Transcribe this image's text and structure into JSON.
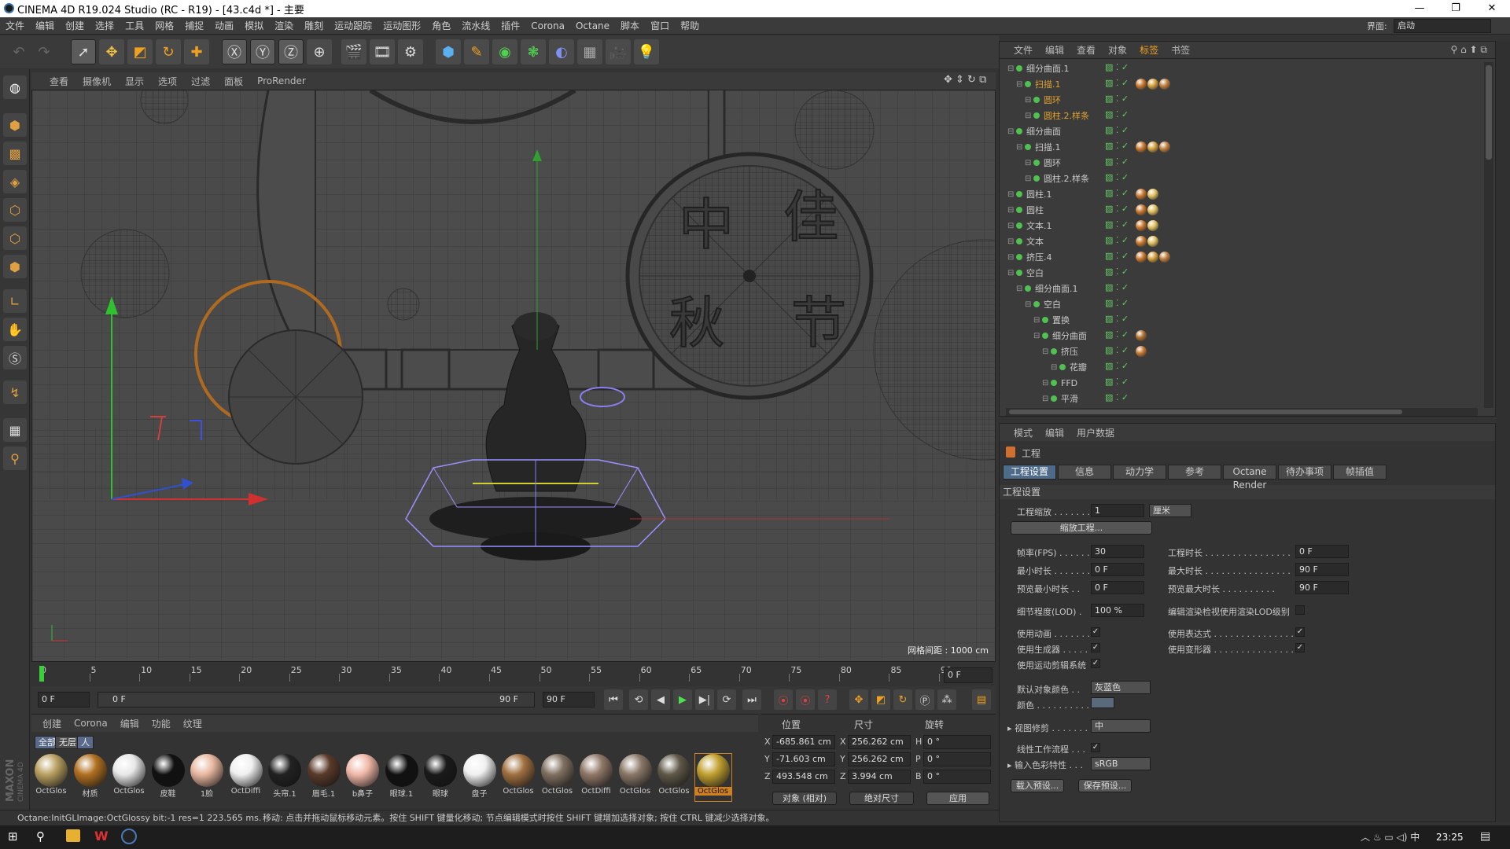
{
  "window": {
    "title": "CINEMA 4D R19.024 Studio (RC - R19) - [43.c4d *] - 主要"
  },
  "menubar": {
    "items": [
      "文件",
      "编辑",
      "创建",
      "选择",
      "工具",
      "网格",
      "捕捉",
      "动画",
      "模拟",
      "渲染",
      "雕刻",
      "运动跟踪",
      "运动图形",
      "角色",
      "流水线",
      "插件",
      "Corona",
      "Octane",
      "脚本",
      "窗口",
      "帮助"
    ],
    "layout_label": "界面:",
    "layout_value": "启动"
  },
  "viewport": {
    "menu": [
      "查看",
      "摄像机",
      "显示",
      "选项",
      "过滤",
      "面板",
      "ProRender"
    ],
    "grid_label": "网格间距 : 1000 cm",
    "characters": [
      "中",
      "佳",
      "秋",
      "节"
    ]
  },
  "timeline": {
    "ticks": [
      "0",
      "5",
      "10",
      "15",
      "20",
      "25",
      "30",
      "35",
      "40",
      "45",
      "50",
      "55",
      "60",
      "65",
      "70",
      "75",
      "80",
      "85",
      "90"
    ],
    "current_frame": "0 F",
    "start": "0 F",
    "range_start": "0 F",
    "range_end": "90 F",
    "end": "90 F"
  },
  "materials": {
    "menu": [
      "创建",
      "Corona",
      "编辑",
      "功能",
      "纹理"
    ],
    "tabs": [
      "全部",
      "无层",
      "人"
    ],
    "items": [
      {
        "label": "OctGlos",
        "color": "#b8a060"
      },
      {
        "label": "材质",
        "color": "#b07020"
      },
      {
        "label": "OctGlos",
        "color": "#e8e8e8"
      },
      {
        "label": "皮鞋",
        "color": "#111111"
      },
      {
        "label": "1脸",
        "color": "#e8b8a0"
      },
      {
        "label": "OctDiffi",
        "color": "#f0f0f0"
      },
      {
        "label": "头帘.1",
        "color": "#222222"
      },
      {
        "label": "眉毛.1",
        "color": "#5a3a2a"
      },
      {
        "label": "b鼻子",
        "color": "#f0b8a8"
      },
      {
        "label": "眼球.1",
        "color": "#111111"
      },
      {
        "label": "眼球",
        "color": "#1a1a1a"
      },
      {
        "label": "盘子",
        "color": "#f0f0f0"
      },
      {
        "label": "OctGlos",
        "color": "#a07040"
      },
      {
        "label": "OctGlos",
        "color": "#807060"
      },
      {
        "label": "OctDiffi",
        "color": "#907868"
      },
      {
        "label": "OctGlos",
        "color": "#8a7868"
      },
      {
        "label": "OctGlos",
        "color": "#605848"
      },
      {
        "label": "OctGlos",
        "color": "#c0a030"
      }
    ]
  },
  "coords": {
    "headers": [
      "位置",
      "尺寸",
      "旋转"
    ],
    "rows": [
      {
        "axis": "X",
        "pos": "-685.861 cm",
        "size_axis": "X",
        "size": "256.262 cm",
        "rot_axis": "H",
        "rot": "0 °"
      },
      {
        "axis": "Y",
        "pos": "-71.603 cm",
        "size_axis": "Y",
        "size": "256.262 cm",
        "rot_axis": "P",
        "rot": "0 °"
      },
      {
        "axis": "Z",
        "pos": "493.548 cm",
        "size_axis": "Z",
        "size": "3.994 cm",
        "rot_axis": "B",
        "rot": "0 °"
      }
    ],
    "mode": "对象 (相对)",
    "size_mode": "绝对尺寸",
    "apply": "应用"
  },
  "object_manager": {
    "menu": [
      "文件",
      "编辑",
      "查看",
      "对象",
      "标签",
      "书签"
    ],
    "rows": [
      {
        "name": "细分曲面.1",
        "indent": 0,
        "color": "#c8c8c8",
        "tags": []
      },
      {
        "name": "扫描.1",
        "indent": 1,
        "color": "#e0a030",
        "tags": [
          "#c87830",
          "#d4a040",
          "#c08040"
        ]
      },
      {
        "name": "圆环",
        "indent": 2,
        "color": "#e0a030",
        "tags": []
      },
      {
        "name": "圆柱.2.样条",
        "indent": 2,
        "color": "#e0a030",
        "tags": []
      },
      {
        "name": "细分曲面",
        "indent": 0,
        "color": "#c8c8c8",
        "tags": []
      },
      {
        "name": "扫描.1",
        "indent": 1,
        "color": "#c8c8c8",
        "tags": [
          "#c87830",
          "#d4a040",
          "#c08040"
        ]
      },
      {
        "name": "圆环",
        "indent": 2,
        "color": "#c8c8c8",
        "tags": []
      },
      {
        "name": "圆柱.2.样条",
        "indent": 2,
        "color": "#c8c8c8",
        "tags": []
      },
      {
        "name": "圆柱.1",
        "indent": 0,
        "color": "#c8c8c8",
        "tags": [
          "#c87830",
          "#e0c060"
        ]
      },
      {
        "name": "圆柱",
        "indent": 0,
        "color": "#c8c8c8",
        "tags": [
          "#c87830",
          "#e0c060"
        ]
      },
      {
        "name": "文本.1",
        "indent": 0,
        "color": "#c8c8c8",
        "tags": [
          "#c87830",
          "#e0c060"
        ]
      },
      {
        "name": "文本",
        "indent": 0,
        "color": "#c8c8c8",
        "tags": [
          "#c87830",
          "#e0c060"
        ]
      },
      {
        "name": "挤压.4",
        "indent": 0,
        "color": "#c8c8c8",
        "tags": [
          "#c87830",
          "#d4a040",
          "#c08040"
        ]
      },
      {
        "name": "空白",
        "indent": 0,
        "color": "#c8c8c8",
        "tags": []
      },
      {
        "name": "细分曲面.1",
        "indent": 1,
        "color": "#c8c8c8",
        "tags": []
      },
      {
        "name": "空白",
        "indent": 2,
        "color": "#c8c8c8",
        "tags": []
      },
      {
        "name": "置换",
        "indent": 3,
        "color": "#c8c8c8",
        "tags": []
      },
      {
        "name": "细分曲面",
        "indent": 3,
        "color": "#c8c8c8",
        "tags": [
          "#b07030"
        ]
      },
      {
        "name": "挤压",
        "indent": 4,
        "color": "#c8c8c8",
        "tags": [
          "#c87830"
        ]
      },
      {
        "name": "花瓣",
        "indent": 5,
        "color": "#c8c8c8",
        "tags": []
      },
      {
        "name": "FFD",
        "indent": 4,
        "color": "#c8c8c8",
        "tags": []
      },
      {
        "name": "平滑",
        "indent": 4,
        "color": "#c8c8c8",
        "tags": []
      }
    ]
  },
  "attributes": {
    "menu": [
      "模式",
      "编辑",
      "用户数据"
    ],
    "title": "工程",
    "tabs": [
      "工程设置",
      "信息",
      "动力学",
      "参考",
      "Octane Render",
      "待办事项",
      "帧插值"
    ],
    "section": "工程设置",
    "scale_label": "工程缩放",
    "scale_value": "1",
    "scale_unit": "厘米",
    "scale_button": "缩放工程...",
    "fps_label": "帧率(FPS)",
    "fps_value": "30",
    "duration_label": "工程时长",
    "duration_value": "0 F",
    "min_label": "最小时长",
    "min_value": "0 F",
    "max_label": "最大时长",
    "max_value": "90 F",
    "pmin_label": "预览最小时长",
    "pmin_value": "0 F",
    "pmax_label": "预览最大时长",
    "pmax_value": "90 F",
    "lod_label": "细节程度(LOD)",
    "lod_value": "100 %",
    "lod_render_label": "编辑渲染检视使用渲染LOD级别",
    "use_anim": "使用动画",
    "use_expr": "使用表达式",
    "use_gen": "使用生成器",
    "use_deform": "使用变形器",
    "use_motion": "使用运动剪辑系统",
    "default_color_label": "默认对象颜色",
    "default_color_value": "灰蓝色",
    "color_label": "颜色",
    "view_clip_label": "视图修剪",
    "view_clip_value": "中",
    "linear_label": "线性工作流程",
    "input_color_label": "输入色彩特性",
    "input_color_value": "sRGB",
    "load_preset": "载入预设...",
    "save_preset": "保存预设..."
  },
  "status": {
    "left": "Octane:InitGLImage:OctGlossy  bit:-1 res=1  223.565 ms.",
    "right": "移动: 点击并拖动鼠标移动元素。按住 SHIFT 键量化移动; 节点编辑模式时按住 SHIFT 键增加选择对象; 按住 CTRL 键减少选择对象。"
  },
  "taskbar": {
    "time": "23:25"
  },
  "vertical_labels": {
    "maxon": "MAXON",
    "c4d": "CINEMA 4D"
  }
}
